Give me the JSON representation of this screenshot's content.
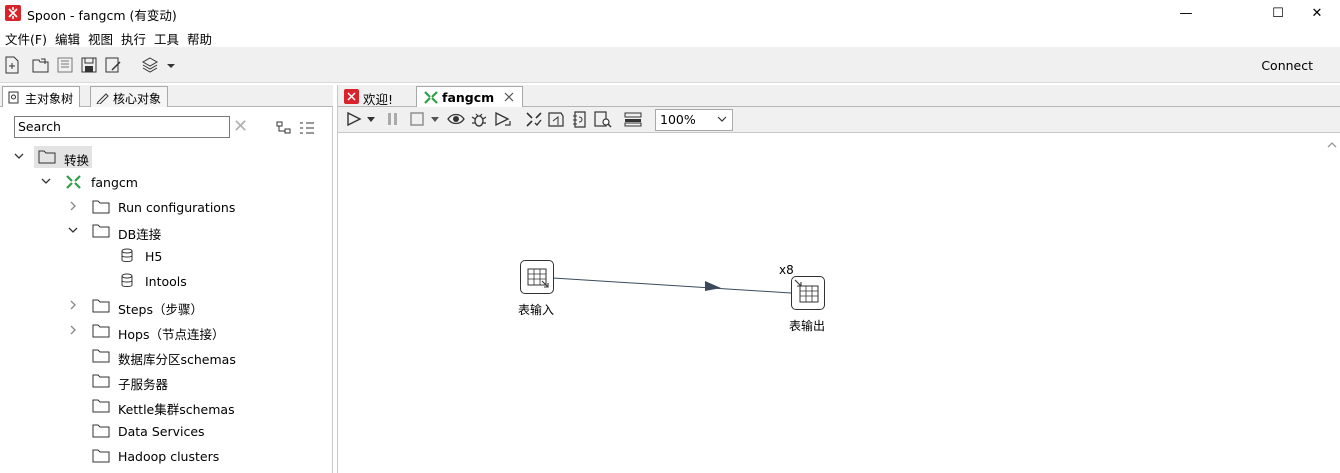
{
  "window": {
    "title": "Spoon - fangcm (有变动)",
    "minimize": "—",
    "maximize": "☐",
    "close": "✕"
  },
  "menu": [
    "文件(F)",
    "编辑",
    "视图",
    "执行",
    "工具",
    "帮助"
  ],
  "toolbar": {
    "connect": "Connect"
  },
  "left_tabs": [
    "主对象树",
    "核心对象"
  ],
  "search": {
    "value": "Search"
  },
  "tree": [
    {
      "label": "转换",
      "expanded": true,
      "selected": true
    },
    {
      "label": "fangcm",
      "expanded": true
    },
    {
      "label": "Run configurations",
      "expanded": false
    },
    {
      "label": "DB连接",
      "expanded": true
    },
    {
      "label": "H5"
    },
    {
      "label": "Intools"
    },
    {
      "label": "Steps（步骤）",
      "expanded": false
    },
    {
      "label": "Hops（节点连接）",
      "expanded": false
    },
    {
      "label": "数据库分区schemas"
    },
    {
      "label": "子服务器"
    },
    {
      "label": "Kettle集群schemas"
    },
    {
      "label": "Data Services"
    },
    {
      "label": "Hadoop clusters"
    }
  ],
  "right_tabs": [
    {
      "label": "欢迎!",
      "active": false
    },
    {
      "label": "fangcm",
      "active": true
    }
  ],
  "zoom": "100%",
  "canvas": {
    "steps": [
      {
        "label": "表输入"
      },
      {
        "label": "表输出",
        "copies": "x8"
      }
    ]
  },
  "colors": {
    "accent_red": "#d8232a",
    "accent_green": "#2e9e44",
    "hop_arrow": "#3a4a5c"
  }
}
